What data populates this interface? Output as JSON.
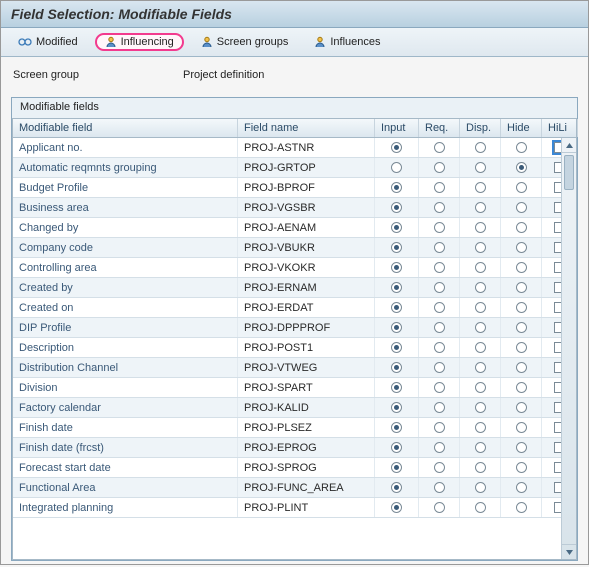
{
  "title": "Field Selection: Modifiable Fields",
  "toolbar": {
    "modified": "Modified",
    "influencing": "Influencing",
    "screen_groups": "Screen groups",
    "influences": "Influences"
  },
  "screen_group": {
    "label": "Screen group",
    "value": "Project definition"
  },
  "panel_title": "Modifiable fields",
  "columns": {
    "field": "Modifiable field",
    "name": "Field name",
    "input": "Input",
    "req": "Req.",
    "disp": "Disp.",
    "hide": "Hide",
    "hili": "HiLi"
  },
  "rows": [
    {
      "field": "Applicant no.",
      "name": "PROJ-ASTNR",
      "sel": "input",
      "hili": false,
      "hl_focus": true
    },
    {
      "field": "Automatic reqmnts grouping",
      "name": "PROJ-GRTOP",
      "sel": "hide",
      "hili": false
    },
    {
      "field": "Budget Profile",
      "name": "PROJ-BPROF",
      "sel": "input",
      "hili": false
    },
    {
      "field": "Business area",
      "name": "PROJ-VGSBR",
      "sel": "input",
      "hili": false
    },
    {
      "field": "Changed by",
      "name": "PROJ-AENAM",
      "sel": "input",
      "hili": false
    },
    {
      "field": "Company code",
      "name": "PROJ-VBUKR",
      "sel": "input",
      "hili": false
    },
    {
      "field": "Controlling area",
      "name": "PROJ-VKOKR",
      "sel": "input",
      "hili": false
    },
    {
      "field": "Created by",
      "name": "PROJ-ERNAM",
      "sel": "input",
      "hili": false
    },
    {
      "field": "Created on",
      "name": "PROJ-ERDAT",
      "sel": "input",
      "hili": false
    },
    {
      "field": "DIP Profile",
      "name": "PROJ-DPPPROF",
      "sel": "input",
      "hili": false
    },
    {
      "field": "Description",
      "name": "PROJ-POST1",
      "sel": "input",
      "hili": false
    },
    {
      "field": "Distribution Channel",
      "name": "PROJ-VTWEG",
      "sel": "input",
      "hili": false
    },
    {
      "field": "Division",
      "name": "PROJ-SPART",
      "sel": "input",
      "hili": false
    },
    {
      "field": "Factory calendar",
      "name": "PROJ-KALID",
      "sel": "input",
      "hili": false
    },
    {
      "field": "Finish date",
      "name": "PROJ-PLSEZ",
      "sel": "input",
      "hili": false
    },
    {
      "field": "Finish date (frcst)",
      "name": "PROJ-EPROG",
      "sel": "input",
      "hili": false
    },
    {
      "field": "Forecast start date",
      "name": "PROJ-SPROG",
      "sel": "input",
      "hili": false
    },
    {
      "field": "Functional Area",
      "name": "PROJ-FUNC_AREA",
      "sel": "input",
      "hili": false
    },
    {
      "field": "Integrated planning",
      "name": "PROJ-PLINT",
      "sel": "input",
      "hili": false
    }
  ]
}
